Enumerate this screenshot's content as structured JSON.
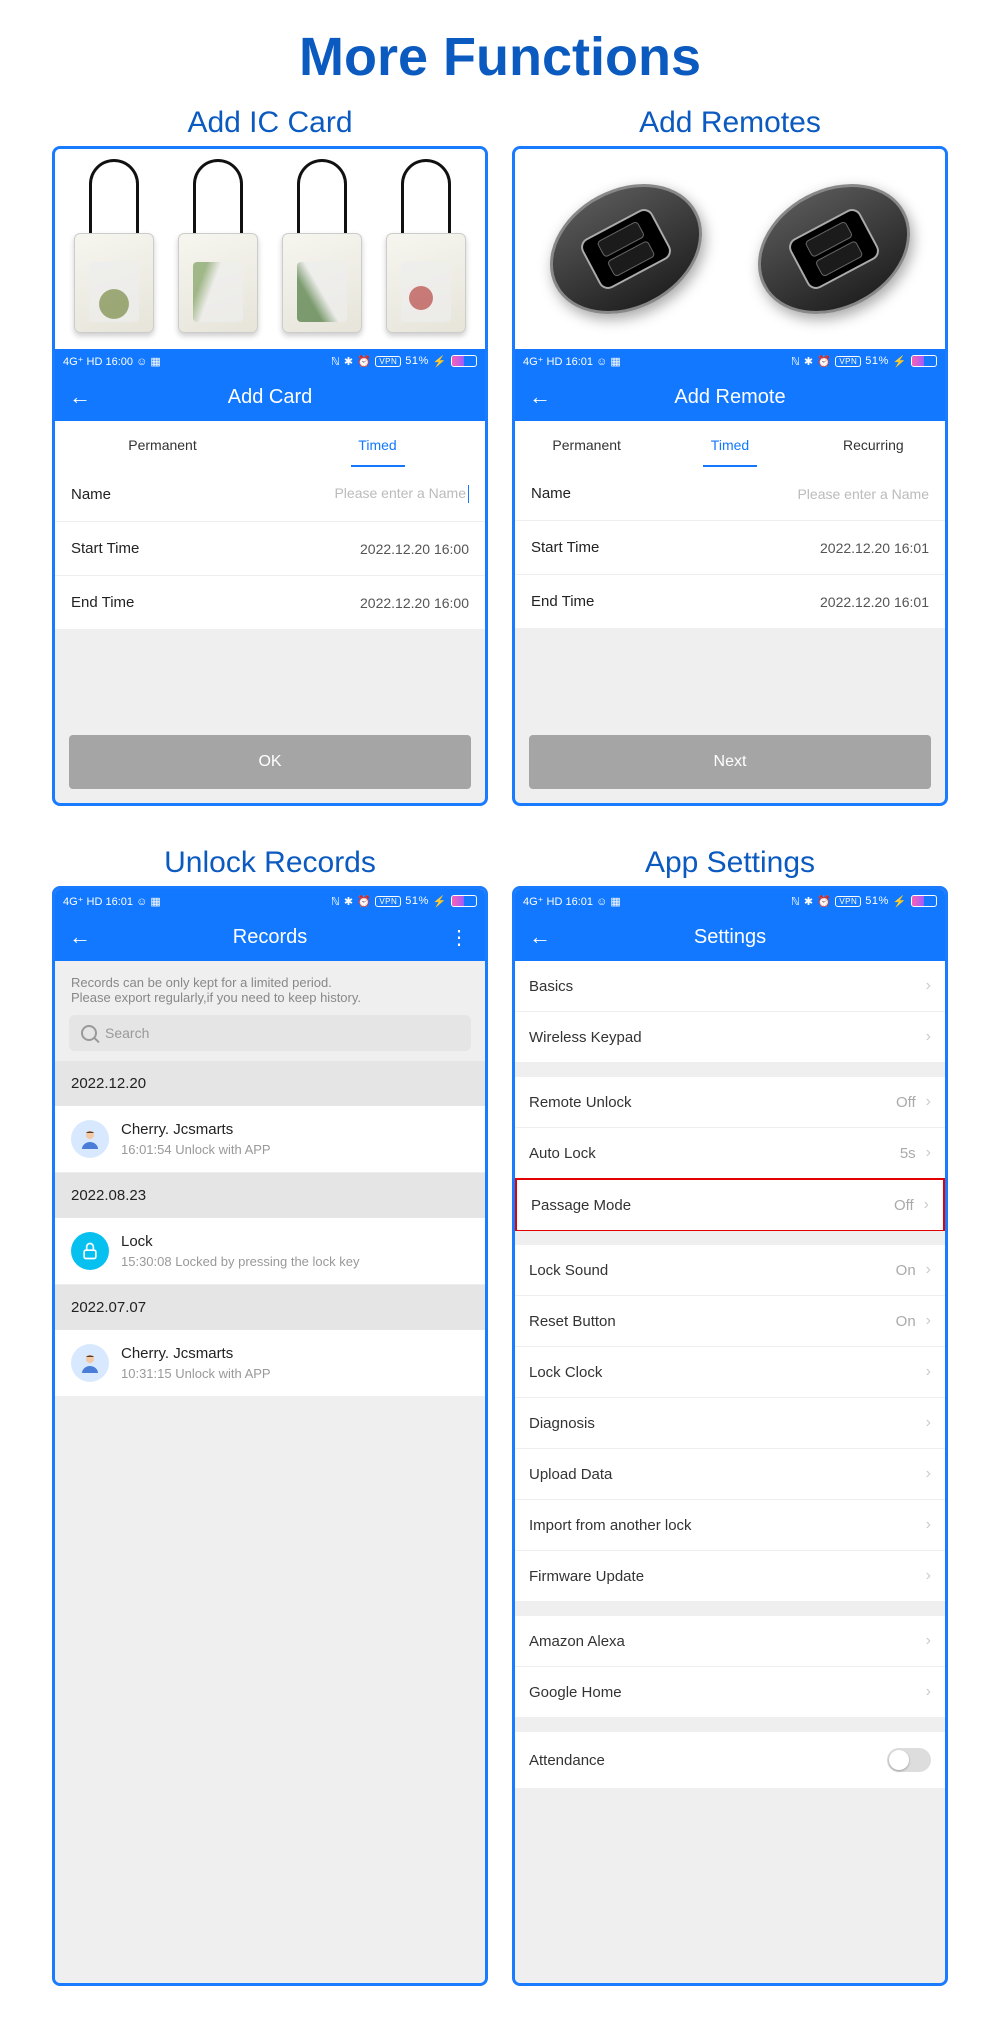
{
  "pageTitle": "More Functions",
  "sections": {
    "addCard": {
      "title": "Add IC Card",
      "statusTime": "16:00",
      "statusBatt": "51%",
      "header": "Add Card",
      "tabs": {
        "permanent": "Permanent",
        "timed": "Timed"
      },
      "activeTab": "Timed",
      "nameLabel": "Name",
      "namePlaceholder": "Please enter a Name",
      "startLabel": "Start Time",
      "startValue": "2022.12.20 16:00",
      "endLabel": "End Time",
      "endValue": "2022.12.20 16:00",
      "okBtn": "OK"
    },
    "addRemote": {
      "title": "Add Remotes",
      "statusTime": "16:01",
      "statusBatt": "51%",
      "header": "Add Remote",
      "tabs": {
        "permanent": "Permanent",
        "timed": "Timed",
        "recurring": "Recurring"
      },
      "activeTab": "Timed",
      "nameLabel": "Name",
      "namePlaceholder": "Please enter a Name",
      "startLabel": "Start Time",
      "startValue": "2022.12.20 16:01",
      "endLabel": "End Time",
      "endValue": "2022.12.20 16:01",
      "nextBtn": "Next"
    },
    "records": {
      "title": "Unlock Records",
      "statusTime": "16:01",
      "statusBatt": "51%",
      "header": "Records",
      "noticeL1": "Records can be only kept for a limited period.",
      "noticeL2": "Please export regularly,if you need to keep history.",
      "searchPlaceholder": "Search",
      "groups": [
        {
          "date": "2022.12.20",
          "items": [
            {
              "kind": "user",
              "title": "Cherry. Jcsmarts",
              "sub": "16:01:54 Unlock with APP"
            }
          ]
        },
        {
          "date": "2022.08.23",
          "items": [
            {
              "kind": "lock",
              "title": "Lock",
              "sub": "15:30:08 Locked by pressing the lock key"
            }
          ]
        },
        {
          "date": "2022.07.07",
          "items": [
            {
              "kind": "user",
              "title": "Cherry. Jcsmarts",
              "sub": "10:31:15 Unlock with APP"
            }
          ]
        }
      ]
    },
    "settings": {
      "title": "App Settings",
      "statusTime": "16:01",
      "statusBatt": "51%",
      "header": "Settings",
      "rows": [
        {
          "label": "Basics",
          "value": ""
        },
        {
          "label": "Wireless Keypad",
          "value": ""
        },
        {
          "gap": true
        },
        {
          "label": "Remote Unlock",
          "value": "Off"
        },
        {
          "label": "Auto Lock",
          "value": "5s"
        },
        {
          "label": "Passage Mode",
          "value": "Off",
          "highlight": true
        },
        {
          "gap": true
        },
        {
          "label": "Lock Sound",
          "value": "On"
        },
        {
          "label": "Reset Button",
          "value": "On"
        },
        {
          "label": "Lock Clock",
          "value": ""
        },
        {
          "label": "Diagnosis",
          "value": ""
        },
        {
          "label": "Upload Data",
          "value": ""
        },
        {
          "label": "Import from another lock",
          "value": ""
        },
        {
          "label": "Firmware Update",
          "value": ""
        },
        {
          "gap": true
        },
        {
          "label": "Amazon Alexa",
          "value": ""
        },
        {
          "label": "Google Home",
          "value": ""
        },
        {
          "gap": true
        },
        {
          "label": "Attendance",
          "value": "",
          "toggle": true
        }
      ]
    }
  },
  "statusLeft": "4G⁺ HD",
  "statusIcons": "ℕ ✱ ⏰",
  "vpnLabel": "VPN"
}
